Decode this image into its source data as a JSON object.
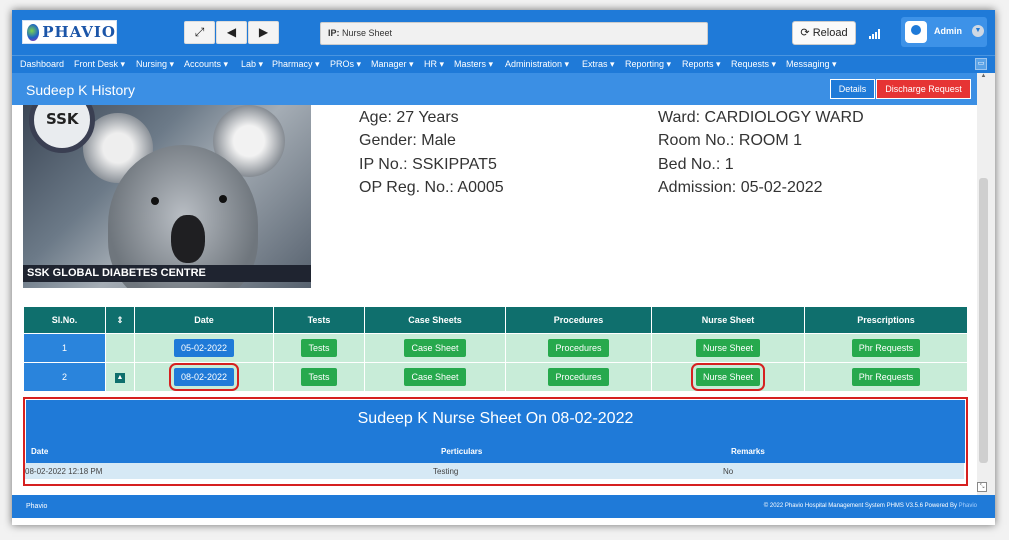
{
  "header": {
    "brand": "PHAVIO",
    "ip_label": "IP:",
    "ip_value": "Nurse Sheet",
    "reload_label": "Reload",
    "user": "Admin"
  },
  "nav": [
    "Dashboard",
    "Front Desk ▾",
    "Nursing ▾",
    "Accounts ▾",
    "Lab ▾",
    "Pharmacy ▾",
    "PROs ▾",
    "Manager ▾",
    "HR ▾",
    "Masters ▾",
    "Administration ▾",
    "Extras ▾",
    "Reporting ▾",
    "Reports ▾",
    "Requests ▾",
    "Messaging ▾"
  ],
  "page": {
    "title": "Sudeep K History",
    "details_label": "Details",
    "discharge_label": "Discharge Request"
  },
  "photo": {
    "badge": "SSK",
    "caption": "SSK GLOBAL DIABETES CENTRE"
  },
  "patient": {
    "age": "Age: 27 Years",
    "gender": "Gender: Male",
    "ip_no": "IP No.: SSKIPPAT5",
    "op_reg": "OP Reg. No.: A0005",
    "ward": "Ward: CARDIOLOGY WARD",
    "room": "Room No.: ROOM 1",
    "bed": "Bed No.: 1",
    "admission": "Admission: 05-02-2022"
  },
  "history": {
    "columns": [
      "Sl.No.",
      "⇕",
      "Date",
      "Tests",
      "Case Sheets",
      "Procedures",
      "Nurse Sheet",
      "Prescriptions"
    ],
    "rows": [
      {
        "sl": "1",
        "date": "05-02-2022",
        "tests": "Tests",
        "case": "Case Sheet",
        "proc": "Procedures",
        "nurse": "Nurse Sheet",
        "presc": "Phr Requests"
      },
      {
        "sl": "2",
        "date": "08-02-2022",
        "tests": "Tests",
        "case": "Case Sheet",
        "proc": "Procedures",
        "nurse": "Nurse Sheet",
        "presc": "Phr Requests"
      }
    ]
  },
  "nurse_sheet": {
    "title": "Sudeep K Nurse Sheet On 08-02-2022",
    "columns": [
      "Date",
      "Perticulars",
      "Remarks"
    ],
    "row": {
      "date": "08-02-2022 12:18 PM",
      "particulars": "Testing",
      "remarks": "No"
    }
  },
  "footer": {
    "left": "Phavio",
    "right": "© 2022 Phavio Hospital Management System PHMS V3.5.6 Powered By",
    "right_brand": "Phavio"
  }
}
